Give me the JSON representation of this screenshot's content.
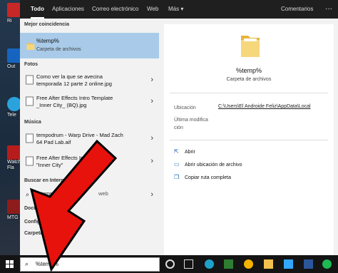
{
  "desktop": {
    "icons": [
      {
        "label": "Ri",
        "color": "#c62828"
      },
      {
        "label": "Out",
        "color": "#1565c0"
      },
      {
        "label": "Tele",
        "color": "#2aa3dd"
      },
      {
        "label": "Watch",
        "color": "#b71c1c"
      },
      {
        "label": "Fla",
        "color": "#555555"
      },
      {
        "label": "MTG",
        "color": "#8d1c1c"
      }
    ]
  },
  "tabs": [
    "Todo",
    "Aplicaciones",
    "Correo electrónico",
    "Web",
    "Más"
  ],
  "tab_more_arrow": "▾",
  "comments_label": "Comentarios",
  "ellipsis": "···",
  "left": {
    "best_match_header": "Mejor coincidencia",
    "best_match": {
      "title": "%temp%",
      "subtitle": "Carpeta de archivos"
    },
    "photos_header": "Fotos",
    "photos": [
      {
        "line1": "Como ver la que se avecina",
        "line2": "temporada 12 parte 2 online.jpg"
      },
      {
        "line1": "Free After Effects Intro Template",
        "line2": "_Inner City_ (BQ).jpg"
      }
    ],
    "music_header": "Música",
    "music": [
      {
        "line1": "tempodrum - Warp Drive - Mad Zach",
        "line2": "64 Pad Lab.aif"
      },
      {
        "line1": "Free After Effects Intro Template",
        "line2": "\"Inner City\""
      }
    ],
    "web_header": "Buscar en Internet",
    "web_item": {
      "query": "%temp%",
      "suffix": "web"
    },
    "docs_header": "Documentos",
    "config_header": "Configuración",
    "folders_header": "Carpetas"
  },
  "right": {
    "title": "%temp%",
    "subtitle": "Carpeta de archivos",
    "location_label": "Ubicación",
    "location_value": "C:\\Users\\El Androide Feliz\\AppData\\Local",
    "modified_label": "Última modifica ción",
    "actions": [
      "Abrir",
      "Abrir ubicación de archivo",
      "Copiar ruta completa"
    ]
  },
  "search": {
    "query": "%temp%",
    "icon": "⌕"
  },
  "taskbar": {
    "icons": [
      {
        "name": "task-view-icon",
        "color": "#dddddd"
      },
      {
        "name": "cortana-icon",
        "color": "#dddddd"
      },
      {
        "name": "edge-icon",
        "color": "#1fa2c9"
      },
      {
        "name": "store-icon",
        "color": "#2e7d32"
      },
      {
        "name": "chrome-icon",
        "color": "#f4b400"
      },
      {
        "name": "explorer-icon",
        "color": "#f2c14e"
      },
      {
        "name": "mail-icon",
        "color": "#1e88e5"
      },
      {
        "name": "photoshop-icon",
        "color": "#31a8ff"
      },
      {
        "name": "word-icon",
        "color": "#2b579a"
      },
      {
        "name": "spotify-icon",
        "color": "#1db954"
      }
    ]
  },
  "colors": {
    "arrow": "#e8120c",
    "highlight": "#a9cbe9",
    "folder": "#f2c14e"
  }
}
